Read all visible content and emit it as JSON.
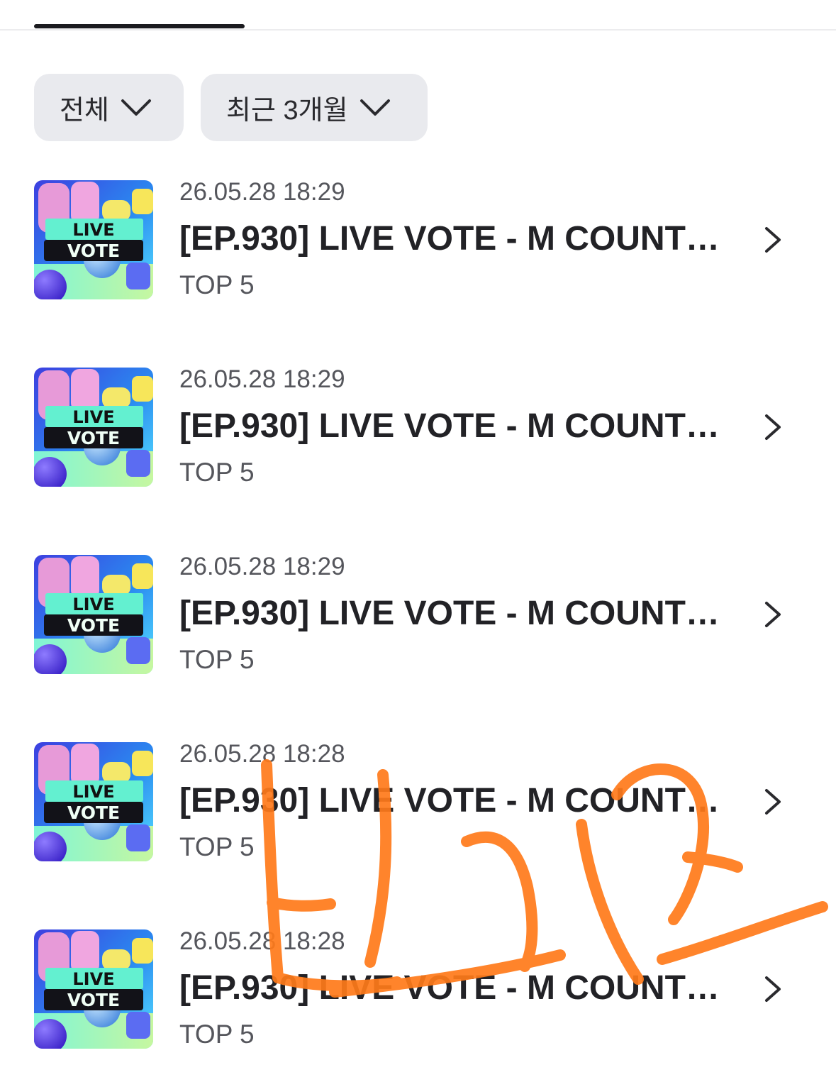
{
  "filters": {
    "category": {
      "label": "전체",
      "icon": "chevron-down-icon"
    },
    "period": {
      "label": "최근 3개월",
      "icon": "chevron-down-icon"
    }
  },
  "items": [
    {
      "date": "26.05.28 18:29",
      "title": "[EP.930] LIVE VOTE - M COUNT…",
      "subtitle": "TOP 5",
      "thumbnail_text": [
        "LIVE",
        "VOTE"
      ]
    },
    {
      "date": "26.05.28 18:29",
      "title": "[EP.930] LIVE VOTE - M COUNT…",
      "subtitle": "TOP 5",
      "thumbnail_text": [
        "LIVE",
        "VOTE"
      ]
    },
    {
      "date": "26.05.28 18:29",
      "title": "[EP.930] LIVE VOTE - M COUNT…",
      "subtitle": "TOP 5",
      "thumbnail_text": [
        "LIVE",
        "VOTE"
      ]
    },
    {
      "date": "26.05.28 18:28",
      "title": "[EP.930] LIVE VOTE - M COUNT…",
      "subtitle": "TOP 5",
      "thumbnail_text": [
        "LIVE",
        "VOTE"
      ]
    },
    {
      "date": "26.05.28 18:28",
      "title": "[EP.930] LIVE VOTE - M COUNT…",
      "subtitle": "TOP 5",
      "thumbnail_text": [
        "LIVE",
        "VOTE"
      ]
    }
  ],
  "colors": {
    "active_tab": "#1b1b1f",
    "filter_bg": "#e9eaee",
    "scribble": "#ff7a1a"
  }
}
